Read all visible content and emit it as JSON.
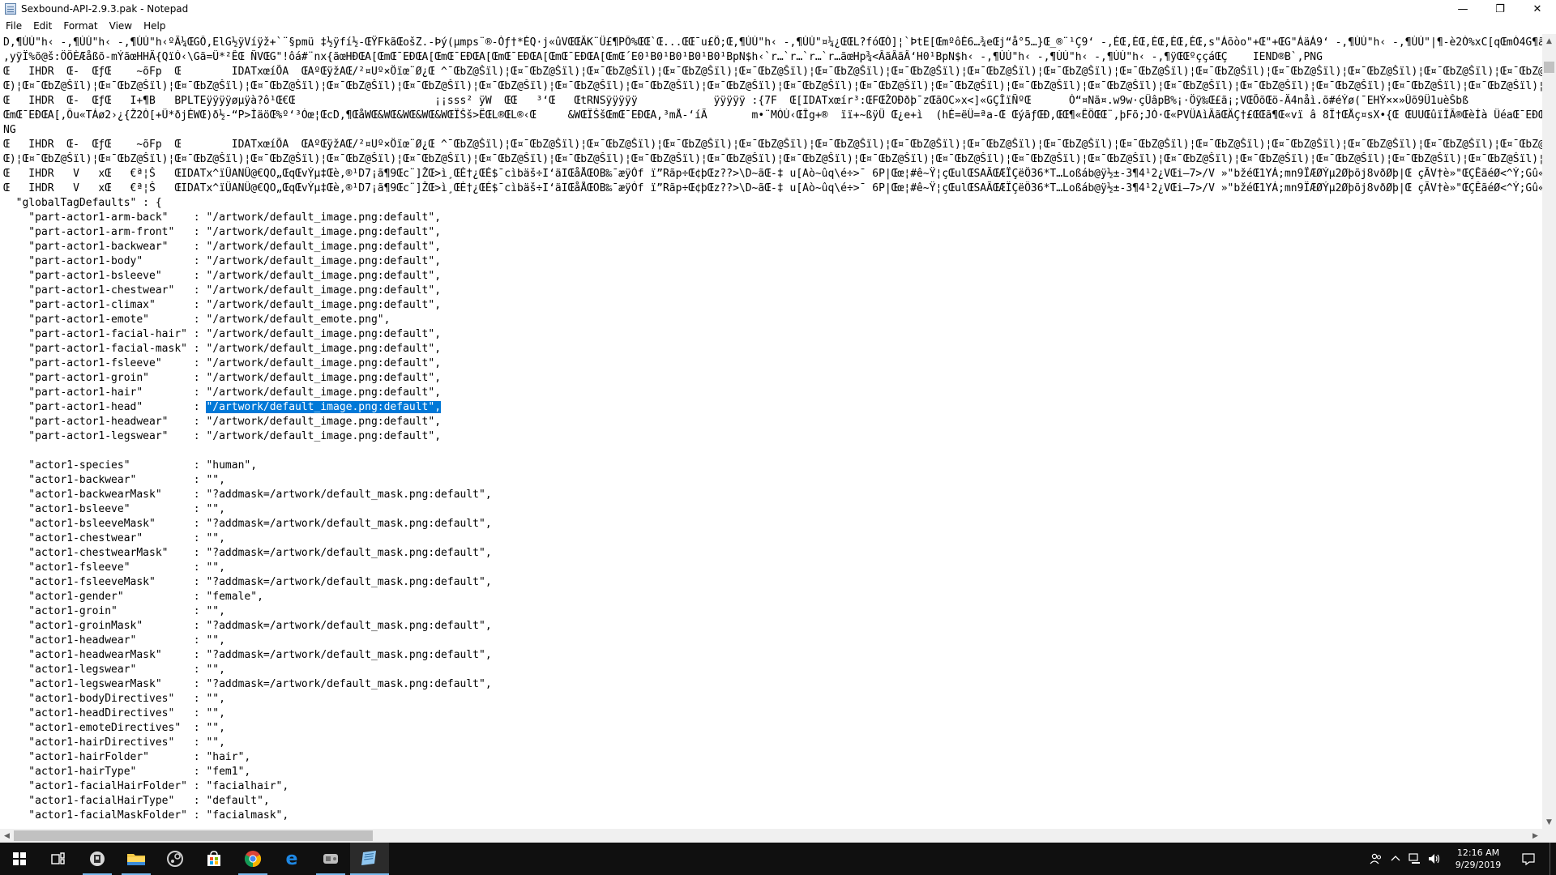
{
  "window": {
    "title": "Sexbound-API-2.9.3.pak - Notepad",
    "minimize": "—",
    "restore": "❐",
    "close": "✕"
  },
  "menu": [
    "File",
    "Edit",
    "Format",
    "View",
    "Help"
  ],
  "editor": {
    "lines": [
      "D,¶ÙÚ\"h‹ -,¶ÙÚ\"h‹ -,¶ÙÚ\"h‹ºÃ¼ŒGÔ,ElG½ÿVíÿž+`¨§pmü ‡½ÿfí½-ŒŸFkãŒošZ.-Þý(µmps¨®-Òƒ†*ÉQ·j«ûVŒŒÄK¨Ü£¶PÔ%ŒŒ`Œ...ŒŒ¯u£Ö;Œ,¶ÙÚ\"h‹ -,¶ÙÚ\"¤¼¿ŒŒL?fóŒÒ]¦`ÞtE[ŒmºôÉ6…¾eŒj“å°5…}Œ_®¨¹Ç9‘ -,ÉŒ,ÉŒ,ÉŒ,ÉŒ,ÉŒ,s\"Áõòo\"+Œ\"+ŒG\"ÁäÁ9‘ -,¶ÙÚ\"h‹ -,¶ÙÚ\"|¶-è2Ò%xC[qŒmÓ4G¶ã÷³ŒWÐŒÏŒ÷",
      ",yÿÏ%õ@š:ÖÖÈÆåßõ-mÝãœHHÄ{QïÓ‹\\Gã=Ü*²ÊŒ ÑVŒG\"!ôá#¨nx{ãœHÐŒA[ŒmŒ¯EÐŒA[ŒmŒ¯EÐŒA[ŒmŒ¯EÐŒA[ŒmŒ¯EÐŒA[ŒmŒ´E0¹B0¹B0¹B0¹B0¹BpN$h‹`r…`r…`r…`r…ãœHp¾<ÂãÂãÂ‘H0¹BpN$h‹ -,¶ÙÚ\"h‹ -,¶ÙÚ\"h‹ -,¶ÙÚ\"h‹ -,¶ÿŒŒºççáŒÇ    IEND®B`‚PNG",
      "Œ   IHDR  Œ-  ŒƒŒ    ~õFp  Œ        IDATxœíÕA  ŒAºŒÿžAŒ/²¤Uº×Öïœ¨Ø¿Œ ^¯ŒbZ@Šïl)¦Œ¤¯ŒbZ@Šïl)¦Œ¤¯ŒbZ@Šïl)¦Œ¤¯ŒbZ@Šïl)¦Œ¤¯ŒbZ@Šïl)¦Œ¤¯ŒbZ@Šïl)¦Œ¤¯ŒbZ@Šïl)¦Œ¤¯ŒbZ@Šïl)¦Œ¤¯ŒbZ@Šïl)¦Œ¤¯ŒbZ@Šïl)¦Œ¤¯ŒbZ@Šïl)¦Œ¤¯ŒbZ@Šïl)¦Œ¤¯ŒbZ@Šïl)¦Œ¤¯ŒbZ@Šïl)¦Œ¤¯ŒbZ@Šïl)¦Œ¤¯ŒbZ@Šïl)¦Œ¤¯ŒbZ@Šïl)¦Œ¤¯ŒbZ@Šïl)¦Œ¤¯ŒbZ@Šïl)¦Œ¤¯ŒbZ@Šïl)¦Œ¤¯ŒbZ@Šïl)¦Œ¤¯ŒbZ@Šïl)¦Œ¤¯ŒbZ@Šïl)¦Œ¤¯ŒbZ@Šïl)¦Œ¤¯ŒbZ@Šïl)",
      "Œ)¦Œ¤¯ŒbZ@Šïl)¦Œ¤¯ŒbZ@Šïl)¦Œ¤¯ŒbZ@Šïl)¦Œ¤¯ŒbZ@Šïl)¦Œ¤¯ŒbZ@Šïl)¦Œ¤¯ŒbZ@Šïl)¦Œ¤¯ŒbZ@Šïl)¦Œ¤¯ŒbZ@Šïl)¦Œ¤¯ŒbZ@Šïl)¦Œ¤¯ŒbZ@Šïl)¦Œ¤¯ŒbZ@Šïl)¦Œ¤¯ŒbZ@Šïl)¦Œ¤¯ŒbZ@Šïl)¦Œ¤¯ŒbZ@Šïl)¦Œ¤¯ŒbZ@Šïl)¦Œ¤¯ŒbZ@Šïl)¦Œ¤¯ŒbZ@Šïl)¦Œ¤¯ŒbZ@Šïl)¦Œ¤¯ŒbZ@Šïl)¦Œ¤¯ŒbZ@Šïl)¦Œ¤¯ŒbZ@Šïl)¦Œ¤¯ŒbZ@Šïl)¦Œ¤¯ŒbZ@Šïl)¦Œ¤¯ŒbZ@Šïl)¦Œ¤¯ŒbZ@Šïl)¦Œ¤¯ŒbZ@Šïl)¦Œ¤¯ŒbZ@Šïl)",
      "Œ   IHDR  Œ-  ŒƒŒ   I+¶B   BPLTEÿÿÿÿøµÿà?ô¹Œ€Œ                      ¡¡sss² ÿW  ŒŒ   ³‘Œ   ŒtRNSÿÿÿÿÿ            ÿÿÿÿÿ :{7F  Œ[IDATxœír³:ŒFŒŽOÐðþ¯zŒãOC»x<]«GÇÎïÑºŒ      Ó“¤Nã¤.w9w·çÜâpB%¡·Öÿ‰Œ£ã¡;VŒÕõŒö-Ä4nåì.õ#éÝø(¯EHÝ××»Ûõ9Ü1uèŠbß",
      "ŒmŒ¯EÐŒA[‚Ôu«TÁø2›¿{Ž2Ò[+Ü*ðjÉWŒ)ð½-“P>ÌäöŒ%º‘³Óœ¦ŒcD,¶ŒåWŒ&WŒ&WŒ&WŒ&WŒÏŠš>ËŒL®ŒL®‹Œ     &WŒÏŠšŒmŒ¯EÐŒA‚³mÅ-‘íÃ       m•¨MÓÙ‹ŒÎg+®  ïï+~ßÿÜ Œ¿e+ì  (hÉ=ëÜ=ªa-Œ ŒýãƒŒÐ,ŒŒ¶«ÊÖŒŒ¨,þFõ;JÓ·Œ«PVÜAìÃãŒÄÇ†£ŒŒã¶Œ«vï â 8Ï†ŒÅç¤sX•{Œ ŒUUŒûïÎÃ®ŒèÍà ÜéaŒ¯EÐŒA[ŒmŒ¯EÐŒ!Ï",
      "NG",
      "Œ   IHDR  Œ-  ŒƒŒ    ~õFp  Œ        IDATxœíÕA  ŒAºŒÿžAŒ/²¤Uº×Öïœ¨Ø¿Œ ^¯ŒbZ@Šïl)¦Œ¤¯ŒbZ@Šïl)¦Œ¤¯ŒbZ@Šïl)¦Œ¤¯ŒbZ@Šïl)¦Œ¤¯ŒbZ@Šïl)¦Œ¤¯ŒbZ@Šïl)¦Œ¤¯ŒbZ@Šïl)¦Œ¤¯ŒbZ@Šïl)¦Œ¤¯ŒbZ@Šïl)¦Œ¤¯ŒbZ@Šïl)¦Œ¤¯ŒbZ@Šïl)¦Œ¤¯ŒbZ@Šïl)¦Œ¤¯ŒbZ@Šïl)¦Œ¤¯ŒbZ@Šïl)¦Œ¤¯ŒbZ@Šïl)¦Œ¤¯ŒbZ@Šïl)¦Œ¤¯ŒbZ@Šïl)¦Œ¤¯ŒbZ@Šïl)¦Œ¤¯ŒbZ@Šïl)¦Œ¤¯ŒbZ@Šïl)¦Œ¤¯ŒbZ@Šïl)¦Œ¤¯ŒbZ@Šïl)¦Œ¤¯ŒbZ@Šïl)¦Œ¤¯ŒbZ@Šïl)¦Œ¤¯ŒbZ@Šïl)",
      "Œ)¦Œ¤¯ŒbZ@Šïl)¦Œ¤¯ŒbZ@Šïl)¦Œ¤¯ŒbZ@Šïl)¦Œ¤¯ŒbZ@Šïl)¦Œ¤¯ŒbZ@Šïl)¦Œ¤¯ŒbZ@Šïl)¦Œ¤¯ŒbZ@Šïl)¦Œ¤¯ŒbZ@Šïl)¦Œ¤¯ŒbZ@Šïl)¦Œ¤¯ŒbZ@Šïl)¦Œ¤¯ŒbZ@Šïl)¦Œ¤¯ŒbZ@Šïl)¦Œ¤¯ŒbZ@Šïl)¦Œ¤¯ŒbZ@Šïl)¦Œ¤¯ŒbZ@Šïl)¦Œ¤¯ŒbZ@Šïl)¦Œ¤¯ŒbZ@Šïl)¦Œ¤¯ŒbZ@Šïl)¦Œ¤¯ŒbZ@Šïl)¦Œ¤¯ŒbZ@Šïl)¦Œ¤¯ŒbZ@Šïl)¦Œ¤¯ŒbZ@Šïl)¦Œ¤¯ŒbZ@Šïl)¦Œ¤¯ŒbZ@Šïl)¦Œ¤¯ŒbZ@Šïl)¦Œ¤¯ŒbZ@Šïl)¦Œ¤¯ŒbZ@Šïl)",
      "Œ   IHDR   V   xŒ   €ª¦Š   ŒIDATx^ïÜANÛ@€QO„ŒqŒvÝµ‡Œè,®¹D7¡ã¶9Œc¨]ŽŒ>ì¸ŒÈ†¿ŒÉ$¯cìbäš÷I‘äIŒåÅŒOB‰¯æÿÓf ï”Rãp÷Œ¢þŒz??>\\D~ãŒ-‡ u[Aò~ûq\\é÷>¯ 6P|Œœ¦#ê~Ÿ¦çŒulŒSAÃŒÆÏÇëÖ36*T…Loßáb@ÿ½±-3¶4¹2¿VŒi–7>/V »\"bžéŒ1YÁ;mn9ÏÆØÝµ2Øþõj8vðØþ|Œ çÃV†è»\"ŒÇÊãéØ<^Ý;Gû«¦",
      "Œ   IHDR   V   xŒ   €ª¦Š   ŒIDATx^ïÜANÛ@€QO„ŒqŒvÝµ‡Œè,®¹D7¡ã¶9Œc¨]ŽŒ>ì¸ŒÈ†¿ŒÉ$¯cìbäš÷I‘äIŒåÅŒOB‰¯æÿÓf ï”Rãp÷Œ¢þŒz??>\\D~ãŒ-‡ u[Aò~ûq\\é÷>¯ 6P|Œœ¦#ê~Ÿ¦çŒulŒSAÃŒÆÏÇëÖ36*T…Loßáb@ÿ½±-3¶4¹2¿VŒi–7>/V »\"bžéŒ1YÁ;mn9ÏÆØÝµ2Øþõj8vðØþ|Œ çÃV†è»\"ŒÇÊãéØ<^Ý;Gû«¦",
      "  \"globalTagDefaults\" : {",
      "    \"part-actor1-arm-back\"    : \"/artwork/default_image.png:default\",",
      "    \"part-actor1-arm-front\"   : \"/artwork/default_image.png:default\",",
      "    \"part-actor1-backwear\"    : \"/artwork/default_image.png:default\",",
      "    \"part-actor1-body\"        : \"/artwork/default_image.png:default\",",
      "    \"part-actor1-bsleeve\"     : \"/artwork/default_image.png:default\",",
      "    \"part-actor1-chestwear\"   : \"/artwork/default_image.png:default\",",
      "    \"part-actor1-climax\"      : \"/artwork/default_image.png:default\",",
      "    \"part-actor1-emote\"       : \"/artwork/default_emote.png\",",
      "    \"part-actor1-facial-hair\" : \"/artwork/default_image.png:default\",",
      "    \"part-actor1-facial-mask\" : \"/artwork/default_image.png:default\",",
      "    \"part-actor1-fsleeve\"     : \"/artwork/default_image.png:default\",",
      "    \"part-actor1-groin\"       : \"/artwork/default_image.png:default\",",
      "    \"part-actor1-hair\"        : \"/artwork/default_image.png:default\",",
      "    \"part-actor1-head\"        : \"/artwork/default_image.png:default\",",
      "    \"part-actor1-headwear\"    : \"/artwork/default_image.png:default\",",
      "    \"part-actor1-legswear\"    : \"/artwork/default_image.png:default\",",
      "",
      "    \"actor1-species\"          : \"human\",",
      "    \"actor1-backwear\"         : \"\",",
      "    \"actor1-backwearMask\"     : \"?addmask=/artwork/default_mask.png:default\",",
      "    \"actor1-bsleeve\"          : \"\",",
      "    \"actor1-bsleeveMask\"      : \"?addmask=/artwork/default_mask.png:default\",",
      "    \"actor1-chestwear\"        : \"\",",
      "    \"actor1-chestwearMask\"    : \"?addmask=/artwork/default_mask.png:default\",",
      "    \"actor1-fsleeve\"          : \"\",",
      "    \"actor1-fsleeveMask\"      : \"?addmask=/artwork/default_mask.png:default\",",
      "    \"actor1-gender\"           : \"female\",",
      "    \"actor1-groin\"            : \"\",",
      "    \"actor1-groinMask\"        : \"?addmask=/artwork/default_mask.png:default\",",
      "    \"actor1-headwear\"         : \"\",",
      "    \"actor1-headwearMask\"     : \"?addmask=/artwork/default_mask.png:default\",",
      "    \"actor1-legswear\"         : \"\",",
      "    \"actor1-legswearMask\"     : \"?addmask=/artwork/default_mask.png:default\",",
      "    \"actor1-bodyDirectives\"   : \"\",",
      "    \"actor1-headDirectives\"   : \"\",",
      "    \"actor1-emoteDirectives\"  : \"\",",
      "    \"actor1-hairDirectives\"   : \"\",",
      "    \"actor1-hairFolder\"       : \"hair\",",
      "    \"actor1-hairType\"         : \"fem1\",",
      "    \"actor1-facialHairFolder\" : \"facialhair\",",
      "    \"actor1-facialHairType\"   : \"default\",",
      "    \"actor1-facialMaskFolder\" : \"facialmask\","
    ],
    "selection": {
      "line": 25,
      "prefix": "    \"part-actor1-head\"        : ",
      "selected": "\"/artwork/default_image.png:default\",",
      "suffix": ""
    }
  },
  "taskbar": {
    "buttons": [
      {
        "name": "start-button",
        "icon": "windows-logo-icon",
        "glyph": "⊞"
      },
      {
        "name": "task-view-button",
        "icon": "task-view-icon",
        "glyph": "⧉"
      },
      {
        "name": "taskbar-app-1",
        "icon": "app-icon",
        "glyph": "☗"
      },
      {
        "name": "taskbar-file-explorer",
        "icon": "folder-icon",
        "glyph": "▬"
      },
      {
        "name": "taskbar-app-steam",
        "icon": "steam-icon",
        "glyph": "◎"
      },
      {
        "name": "taskbar-store",
        "icon": "store-bag-icon",
        "glyph": "▣"
      },
      {
        "name": "taskbar-chrome",
        "icon": "chrome-icon",
        "glyph": "◉"
      },
      {
        "name": "taskbar-edge",
        "icon": "edge-icon",
        "glyph": "e"
      },
      {
        "name": "taskbar-app-game",
        "icon": "game-icon",
        "glyph": "◈"
      },
      {
        "name": "taskbar-notepad",
        "icon": "notepad-icon",
        "glyph": "✎"
      }
    ],
    "colors": {
      "background": "#101010",
      "accent": "#76b9ed",
      "selection": "#0078d7"
    },
    "tray": {
      "people_icon": "people-icon",
      "chevron_icon": "chevron-up-icon",
      "network_icon": "network-icon",
      "volume_icon": "volume-icon",
      "time": "12:16 AM",
      "date": "9/29/2019",
      "notification_icon": "action-center-icon"
    }
  }
}
